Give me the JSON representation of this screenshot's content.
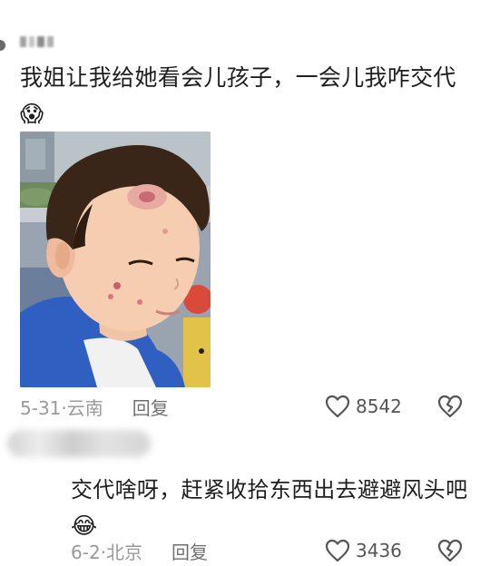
{
  "comment": {
    "author_name": "",
    "text": "我姐让我给她看会儿孩子，一会儿我咋交代",
    "emoji": "😱",
    "date_location": "5-31·云南",
    "reply_label": "回复",
    "like_count": "8542",
    "like_icon": "heart-outline-icon",
    "dislike_icon": "broken-heart-icon"
  },
  "reply": {
    "author_name": "",
    "text": "交代啥呀，赶紧收拾东西出去避避风头吧",
    "emoji": "😂",
    "date_location": "6-2·北京",
    "reply_label": "回复",
    "like_count": "3436",
    "like_icon": "heart-outline-icon",
    "dislike_icon": "broken-heart-icon"
  }
}
